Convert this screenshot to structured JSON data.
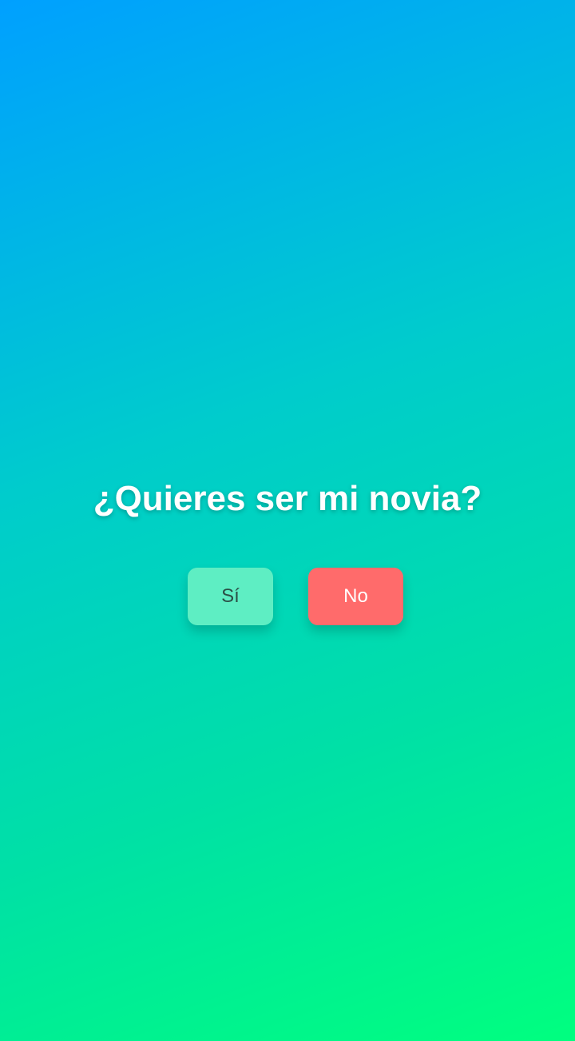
{
  "question": "¿Quieres ser mi novia?",
  "buttons": {
    "yes_label": "Sí",
    "no_label": "No"
  },
  "colors": {
    "background_start": "#00a0ff",
    "background_end": "#00ff7f",
    "yes_button": "#5eeec3",
    "no_button": "#ff6b6b"
  }
}
